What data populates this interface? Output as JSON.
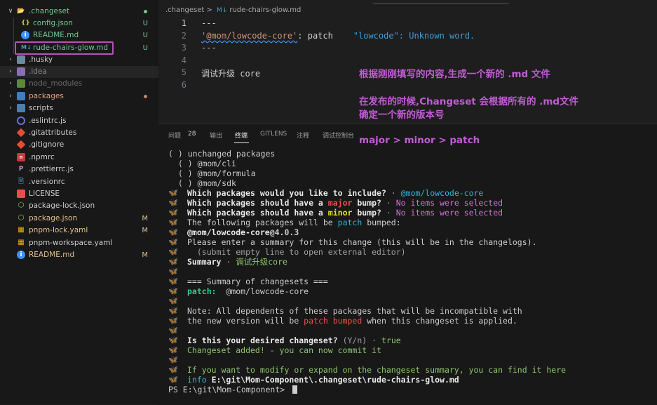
{
  "explorer": {
    "items": [
      {
        "label": ".changeset",
        "kind": "folder-open",
        "badge": "",
        "dot": "#73c991",
        "color": "#73c991"
      },
      {
        "label": "config.json",
        "kind": "json",
        "badge": "U",
        "dot": "",
        "color": "#73c991"
      },
      {
        "label": "README.md",
        "kind": "info",
        "badge": "U",
        "dot": "",
        "color": "#73c991"
      },
      {
        "label": "rude-chairs-glow.md",
        "kind": "md",
        "badge": "U",
        "dot": "",
        "color": "#73c991"
      },
      {
        "label": ".husky",
        "kind": "folder",
        "badge": "",
        "dot": "",
        "color": "#cccccc"
      },
      {
        "label": ".idea",
        "kind": "folder",
        "badge": "",
        "dot": "",
        "color": "#8b8b8b"
      },
      {
        "label": "node_modules",
        "kind": "folder",
        "badge": "",
        "dot": "",
        "color": "#6b6b6b"
      },
      {
        "label": "packages",
        "kind": "folder",
        "badge": "",
        "dot": "#c4866e",
        "color": "#e2a37f"
      },
      {
        "label": "scripts",
        "kind": "folder",
        "badge": "",
        "dot": "",
        "color": "#cccccc"
      },
      {
        "label": ".eslintrc.js",
        "kind": "eslint",
        "badge": "",
        "dot": "",
        "color": "#cccccc"
      },
      {
        "label": ".gitattributes",
        "kind": "git",
        "badge": "",
        "dot": "",
        "color": "#cccccc"
      },
      {
        "label": ".gitignore",
        "kind": "git",
        "badge": "",
        "dot": "",
        "color": "#cccccc"
      },
      {
        "label": ".npmrc",
        "kind": "npm",
        "badge": "",
        "dot": "",
        "color": "#cccccc"
      },
      {
        "label": ".prettierrc.js",
        "kind": "prettier",
        "badge": "",
        "dot": "",
        "color": "#cccccc"
      },
      {
        "label": ".versionrc",
        "kind": "file",
        "badge": "",
        "dot": "",
        "color": "#cccccc"
      },
      {
        "label": "LICENSE",
        "kind": "license",
        "badge": "",
        "dot": "",
        "color": "#cccccc"
      },
      {
        "label": "package-lock.json",
        "kind": "nodejs",
        "badge": "",
        "dot": "",
        "color": "#cccccc"
      },
      {
        "label": "package.json",
        "kind": "nodejs",
        "badge": "M",
        "dot": "",
        "color": "#e2c08d"
      },
      {
        "label": "pnpm-lock.yaml",
        "kind": "pnpm",
        "badge": "M",
        "dot": "",
        "color": "#e2c08d"
      },
      {
        "label": "pnpm-workspace.yaml",
        "kind": "pnpm",
        "badge": "",
        "dot": "",
        "color": "#cccccc"
      },
      {
        "label": "README.md",
        "kind": "info",
        "badge": "M",
        "dot": "",
        "color": "#e2c08d"
      }
    ]
  },
  "editor": {
    "breadcrumb": {
      "folder": ".changeset",
      "sep": ">",
      "md_icon": "M↓",
      "file": "rude-chairs-glow.md"
    },
    "lines": [
      {
        "num": "1",
        "text": "---"
      },
      {
        "num": "2",
        "key": "'@mom/lowcode-core'",
        "mid": ": patch",
        "warning": "\"lowcode\": Unknown word."
      },
      {
        "num": "3",
        "text": "---"
      },
      {
        "num": "4",
        "text": ""
      },
      {
        "num": "5",
        "text": "调试升级 core"
      },
      {
        "num": "6",
        "text": ""
      }
    ]
  },
  "annotations": {
    "line1": "根据刚刚填写的内容,生成一个新的 .md 文件",
    "line2": "在发布的时候,Changeset 会根据所有的 .md文件",
    "line3": "确定一个新的版本号",
    "line4": "major > minor > patch"
  },
  "panel": {
    "tabs": {
      "problems": "问题",
      "problems_count": "28",
      "output": "输出",
      "terminal": "终端",
      "gitlens": "GITLENS",
      "comments": "注释",
      "debug": "调试控制台"
    }
  },
  "terminal": {
    "l1": "( ) unchanged packages",
    "l2": "  ( ) @mom/cli",
    "l3": "  ( ) @mom/formula",
    "l4": "  ( ) @mom/sdk",
    "q1": "Which packages would you like to include?",
    "q1_dot": " · ",
    "q1_ans": "@mom/lowcode-core",
    "q2a": "Which packages should have a ",
    "q2_major": "major",
    "q2b": " bump?",
    "q2_dot": " · ",
    "q2_ans": "No items were selected",
    "q3a": "Which packages should have a ",
    "q3_minor": "minor",
    "q3b": " bump?",
    "q3_dot": " · ",
    "q3_ans": "No items were selected",
    "f1a": "The following packages will be ",
    "f1_patch": "patch",
    "f1b": " bumped:",
    "pkg_name": "@mom/lowcode-core",
    "pkg_ver": "@4.0.3",
    "summary_prompt": "Please enter a summary for this change (this will be in the changelogs).",
    "summary_hint": "  (submit empty line to open external editor)",
    "summary_label": "Summary",
    "summary_dot": " · ",
    "summary_value": "调试升级core",
    "sum_header": "=== Summary of changesets ===",
    "sum_patch": "patch:",
    "sum_patch_pkg": "  @mom/lowcode-core",
    "note1": "Note: All dependents of these packages that will be incompatible with",
    "note2a": "the new version will be ",
    "note2_red": "patch bumped",
    "note2b": " when this changeset is applied.",
    "confirm_q": "Is this your desired changeset?",
    "confirm_yn": " (Y/n)",
    "confirm_dot": " · ",
    "confirm_ans": "true",
    "added": "Changeset added! - you can now commit it",
    "modify": "If you want to modify or expand on the changeset summary, you can find it here",
    "info_label": "info",
    "info_path": " E:\\git\\Mom-Component\\.changeset\\rude-chairs-glow.md",
    "prompt": "PS E:\\git\\Mom-Component> "
  }
}
